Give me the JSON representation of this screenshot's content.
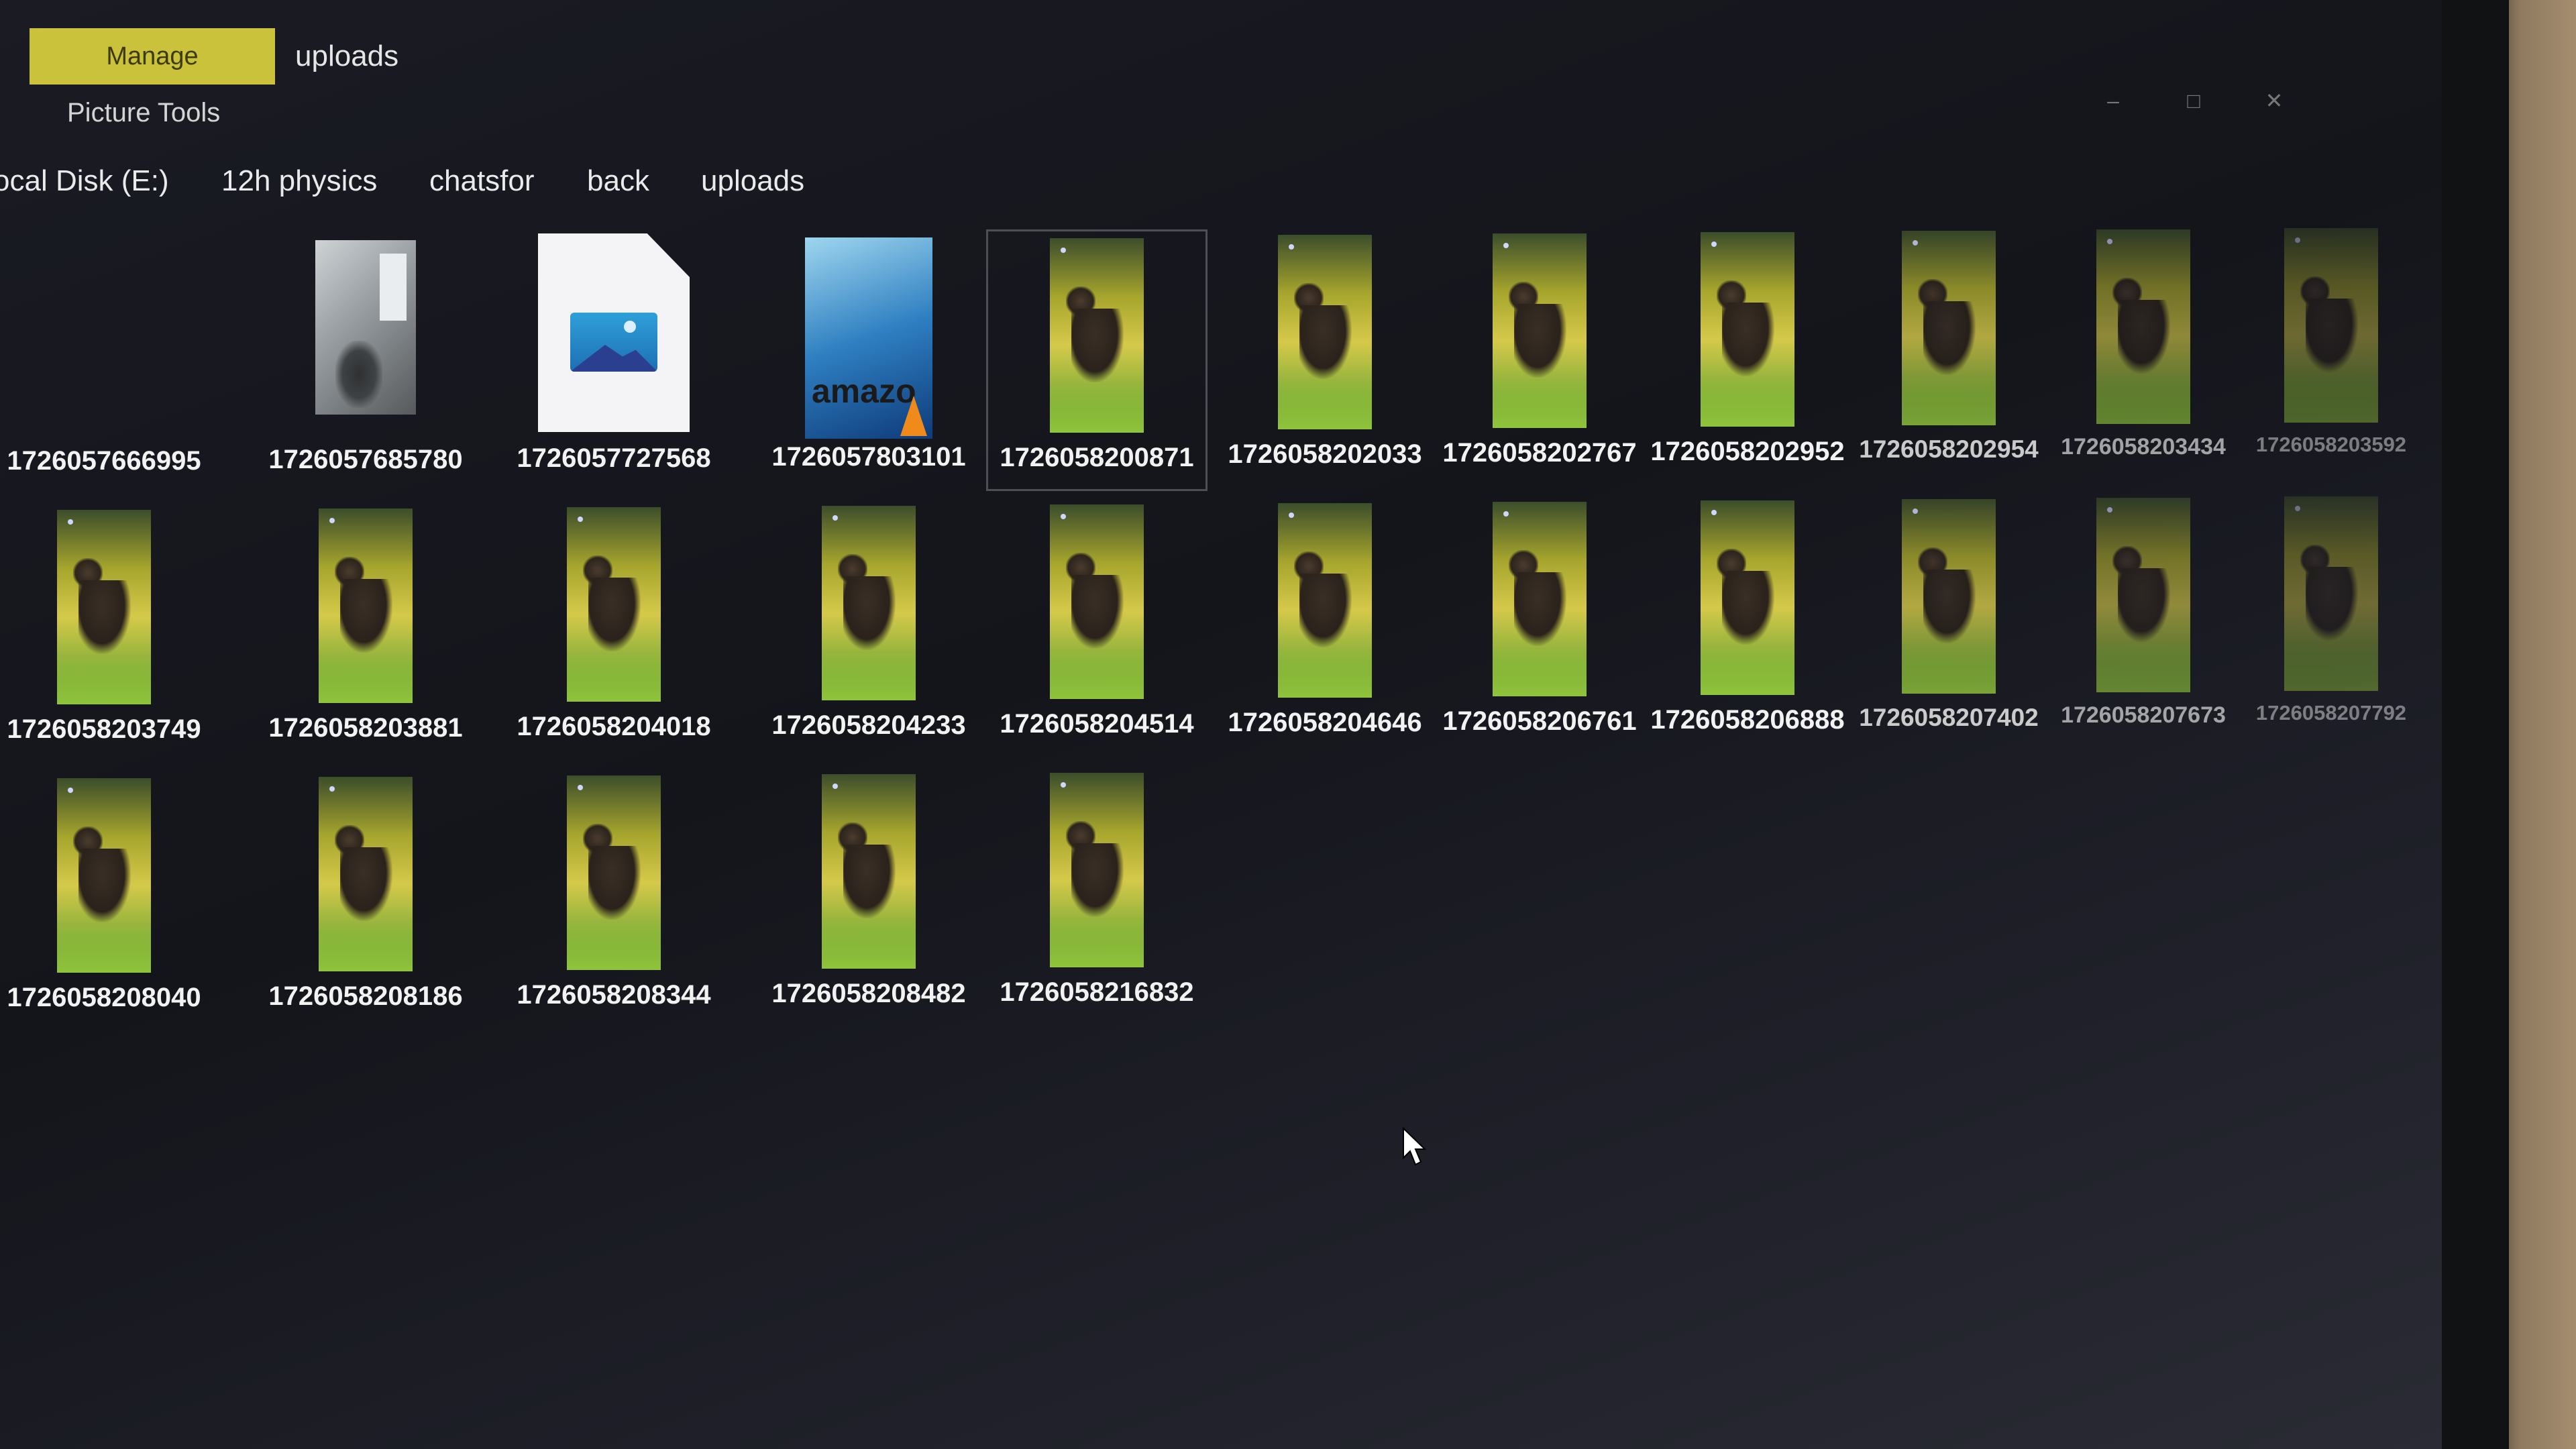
{
  "ribbon": {
    "manage_tab": "Manage",
    "uploads_tab": "uploads",
    "picture_tools": "Picture Tools"
  },
  "breadcrumb": [
    "ocal Disk (E:)",
    "12h physics",
    "chatsfor",
    "back",
    "uploads"
  ],
  "files": [
    {
      "name": "1726057666995",
      "thumb": "empty"
    },
    {
      "name": "1726057685780",
      "thumb": "photo"
    },
    {
      "name": "1726057727568",
      "thumb": "image-file-icon"
    },
    {
      "name": "1726057803101",
      "thumb": "amazon-vlc"
    },
    {
      "name": "1726058200871",
      "thumb": "bear",
      "selected": true
    },
    {
      "name": "1726058202033",
      "thumb": "bear"
    },
    {
      "name": "1726058202767",
      "thumb": "bear"
    },
    {
      "name": "1726058202952",
      "thumb": "bear"
    },
    {
      "name": "1726058202954",
      "thumb": "bear"
    },
    {
      "name": "1726058203434",
      "thumb": "bear"
    },
    {
      "name": "1726058203592",
      "thumb": "bear"
    },
    {
      "name": "1726058203749",
      "thumb": "bear"
    },
    {
      "name": "1726058203881",
      "thumb": "bear"
    },
    {
      "name": "1726058204018",
      "thumb": "bear"
    },
    {
      "name": "1726058204233",
      "thumb": "bear"
    },
    {
      "name": "1726058204514",
      "thumb": "bear"
    },
    {
      "name": "1726058204646",
      "thumb": "bear"
    },
    {
      "name": "1726058206761",
      "thumb": "bear"
    },
    {
      "name": "1726058206888",
      "thumb": "bear"
    },
    {
      "name": "1726058207402",
      "thumb": "bear"
    },
    {
      "name": "1726058207673",
      "thumb": "bear"
    },
    {
      "name": "1726058207792",
      "thumb": "bear"
    },
    {
      "name": "1726058208040",
      "thumb": "bear"
    },
    {
      "name": "1726058208186",
      "thumb": "bear"
    },
    {
      "name": "1726058208344",
      "thumb": "bear"
    },
    {
      "name": "1726058208482",
      "thumb": "bear"
    },
    {
      "name": "1726058216832",
      "thumb": "bear"
    }
  ],
  "colors": {
    "manage_tab_bg": "#c9c23a",
    "screen_bg": "#1a1b23"
  }
}
